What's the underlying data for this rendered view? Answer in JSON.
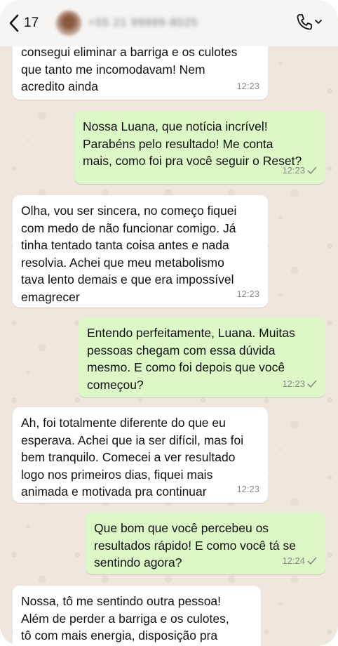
{
  "header": {
    "back_count": "17",
    "contact_name": "+55 21 99999-8025"
  },
  "messages": [
    {
      "direction": "in",
      "text": "consegui eliminar a barriga e os culotes\nque tanto me incomodavam! Nem\nacredito ainda",
      "time": "12:23"
    },
    {
      "direction": "out",
      "text": "Nossa Luana, que notícia incrível!\nParabéns pelo resultado! Me conta\nmais, como foi pra você seguir o Reset?",
      "time": "12:23"
    },
    {
      "direction": "in",
      "text": "Olha, vou ser sincera, no começo fiquei\ncom medo de não funcionar comigo. Já\ntinha tentado tanta coisa antes e nada\nresolvia. Achei que meu metabolismo\ntava lento demais e que era impossível\nemagrecer",
      "time": "12:23"
    },
    {
      "direction": "out",
      "text": "Entendo perfeitamente, Luana. Muitas\npessoas chegam com essa dúvida\nmesmo. E como foi depois que você\ncomeçou?",
      "time": "12:23"
    },
    {
      "direction": "in",
      "text": "Ah, foi totalmente diferente do que eu\nesperava. Achei que ia ser difícil, mas foi\nbem tranquilo. Comecei a ver resultado\nlogo nos primeiros dias, fiquei mais\nanimada e motivada pra continuar",
      "time": "12:23"
    },
    {
      "direction": "out",
      "text": "Que bom que você percebeu os\nresultados rápido! E como você tá se\nsentindo agora?",
      "time": "12:24"
    },
    {
      "direction": "in",
      "text": "Nossa, tô me sentindo outra pessoa!\nAlém de perder a barriga e os culotes,\ntô com mais energia, disposição pra",
      "time": ""
    }
  ]
}
